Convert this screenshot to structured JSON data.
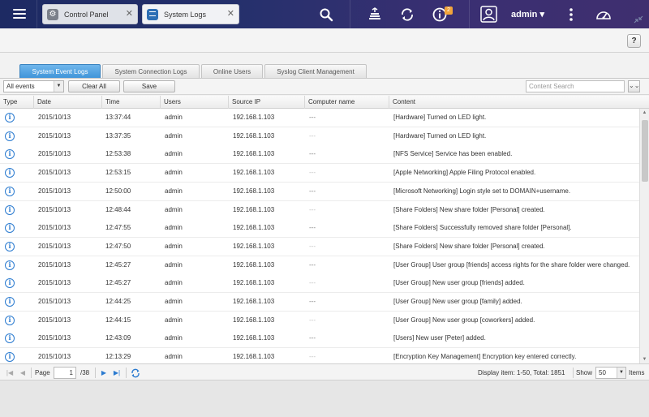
{
  "topbar": {
    "tabs": [
      {
        "label": "Control Panel",
        "icon": "gear-icon",
        "active": false
      },
      {
        "label": "System Logs",
        "icon": "log-icon",
        "active": true
      }
    ],
    "notification_count": "2",
    "user": "admin ▾",
    "icons": [
      "menu-icon",
      "search-icon",
      "stack-icon",
      "sync-icon",
      "info-icon",
      "user-icon",
      "kebab-icon",
      "dashboard-icon"
    ]
  },
  "window": {
    "help_label": "?"
  },
  "content_tabs": [
    {
      "label": "System Event Logs",
      "active": true
    },
    {
      "label": "System Connection Logs",
      "active": false
    },
    {
      "label": "Online Users",
      "active": false
    },
    {
      "label": "Syslog Client Management",
      "active": false
    }
  ],
  "toolbar": {
    "filter_value": "All events",
    "clear_all_label": "Clear All",
    "save_label": "Save",
    "search_placeholder": "Content Search"
  },
  "table": {
    "columns": [
      "Type",
      "Date",
      "Time",
      "Users",
      "Source IP",
      "Computer name",
      "Content"
    ],
    "rows": [
      {
        "date": "2015/10/13",
        "time": "13:37:44",
        "user": "admin",
        "ip": "192.168.1.103",
        "computer": "---",
        "content": "[Hardware] Turned on LED light."
      },
      {
        "date": "2015/10/13",
        "time": "13:37:35",
        "user": "admin",
        "ip": "192.168.1.103",
        "computer": "---",
        "content": "[Hardware] Turned on LED light."
      },
      {
        "date": "2015/10/13",
        "time": "12:53:38",
        "user": "admin",
        "ip": "192.168.1.103",
        "computer": "---",
        "content": "[NFS Service] Service has been enabled."
      },
      {
        "date": "2015/10/13",
        "time": "12:53:15",
        "user": "admin",
        "ip": "192.168.1.103",
        "computer": "---",
        "content": "[Apple Networking] Apple Filing Protocol enabled."
      },
      {
        "date": "2015/10/13",
        "time": "12:50:00",
        "user": "admin",
        "ip": "192.168.1.103",
        "computer": "---",
        "content": "[Microsoft Networking] Login style set to DOMAIN+username."
      },
      {
        "date": "2015/10/13",
        "time": "12:48:44",
        "user": "admin",
        "ip": "192.168.1.103",
        "computer": "---",
        "content": "[Share Folders] New share folder [Personal] created."
      },
      {
        "date": "2015/10/13",
        "time": "12:47:55",
        "user": "admin",
        "ip": "192.168.1.103",
        "computer": "---",
        "content": "[Share Folders] Successfully removed share folder [Personal]."
      },
      {
        "date": "2015/10/13",
        "time": "12:47:50",
        "user": "admin",
        "ip": "192.168.1.103",
        "computer": "---",
        "content": "[Share Folders] New share folder [Personal] created."
      },
      {
        "date": "2015/10/13",
        "time": "12:45:27",
        "user": "admin",
        "ip": "192.168.1.103",
        "computer": "---",
        "content": "[User Group] User group [friends] access rights for the share folder were changed."
      },
      {
        "date": "2015/10/13",
        "time": "12:45:27",
        "user": "admin",
        "ip": "192.168.1.103",
        "computer": "---",
        "content": "[User Group] New user group [friends] added."
      },
      {
        "date": "2015/10/13",
        "time": "12:44:25",
        "user": "admin",
        "ip": "192.168.1.103",
        "computer": "---",
        "content": "[User Group] New user group [family] added."
      },
      {
        "date": "2015/10/13",
        "time": "12:44:15",
        "user": "admin",
        "ip": "192.168.1.103",
        "computer": "---",
        "content": "[User Group] New user group [coworkers] added."
      },
      {
        "date": "2015/10/13",
        "time": "12:43:09",
        "user": "admin",
        "ip": "192.168.1.103",
        "computer": "---",
        "content": "[Users] New user [Peter] added."
      },
      {
        "date": "2015/10/13",
        "time": "12:13:29",
        "user": "admin",
        "ip": "192.168.1.103",
        "computer": "---",
        "content": "[Encryption Key Management] Encryption key entered correctly."
      }
    ]
  },
  "pager": {
    "page_label": "Page",
    "page_value": "1",
    "total_pages": "/38",
    "display_info": "Display item: 1-50, Total: 1851",
    "show_label": "Show",
    "show_value": "50",
    "items_label": "Items"
  },
  "colors": {
    "topbar_start": "#1d2a63",
    "topbar_end": "#3f2f6f",
    "active_tab": "#3d93d8",
    "info_icon": "#2b7bd0",
    "badge": "#f2a43a"
  }
}
